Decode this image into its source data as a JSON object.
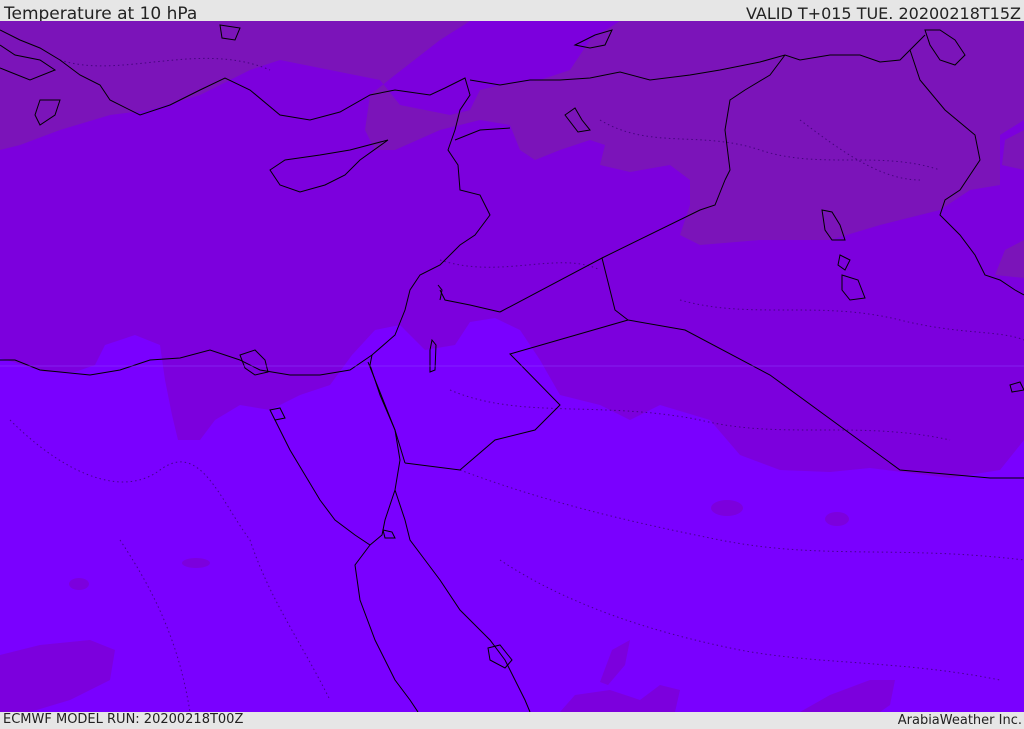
{
  "header": {
    "title": "Temperature at 10 hPa",
    "valid": "VALID T+015 TUE. 20200218T15Z"
  },
  "footer": {
    "model_run": "ECMWF MODEL RUN: 20200218T00Z",
    "credit": "ArabiaWeather Inc."
  },
  "map": {
    "region": "Eastern Mediterranean and Middle East",
    "colors": {
      "warmer_band": "#7a00ff",
      "middle_band": "#7c00dd",
      "colder_band": "#7b14b9",
      "coastline": "#000000"
    }
  }
}
